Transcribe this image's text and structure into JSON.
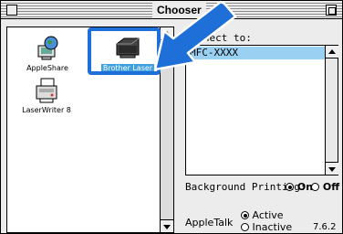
{
  "window": {
    "title": "Chooser"
  },
  "devices": [
    {
      "label": "AppleShare",
      "icon": "appleshare-icon"
    },
    {
      "label": "LaserWriter 8",
      "icon": "laserwriter-icon"
    },
    {
      "label": "Brother Laser",
      "icon": "brother-laser-icon",
      "selected": true
    }
  ],
  "connect": {
    "label": "Connect to:",
    "printers": [
      "MFC-XXXX"
    ]
  },
  "background_printing": {
    "label": "Background Printing:",
    "on_label": "On",
    "off_label": "Off",
    "selected": "On"
  },
  "appletalk": {
    "label": "AppleTalk",
    "active_label": "Active",
    "inactive_label": "Inactive",
    "selected": "Active"
  },
  "version": "7.6.2",
  "colors": {
    "highlight": "#1e6fd8",
    "selection": "#9ad0f2",
    "label_select": "#3fa0e0"
  }
}
